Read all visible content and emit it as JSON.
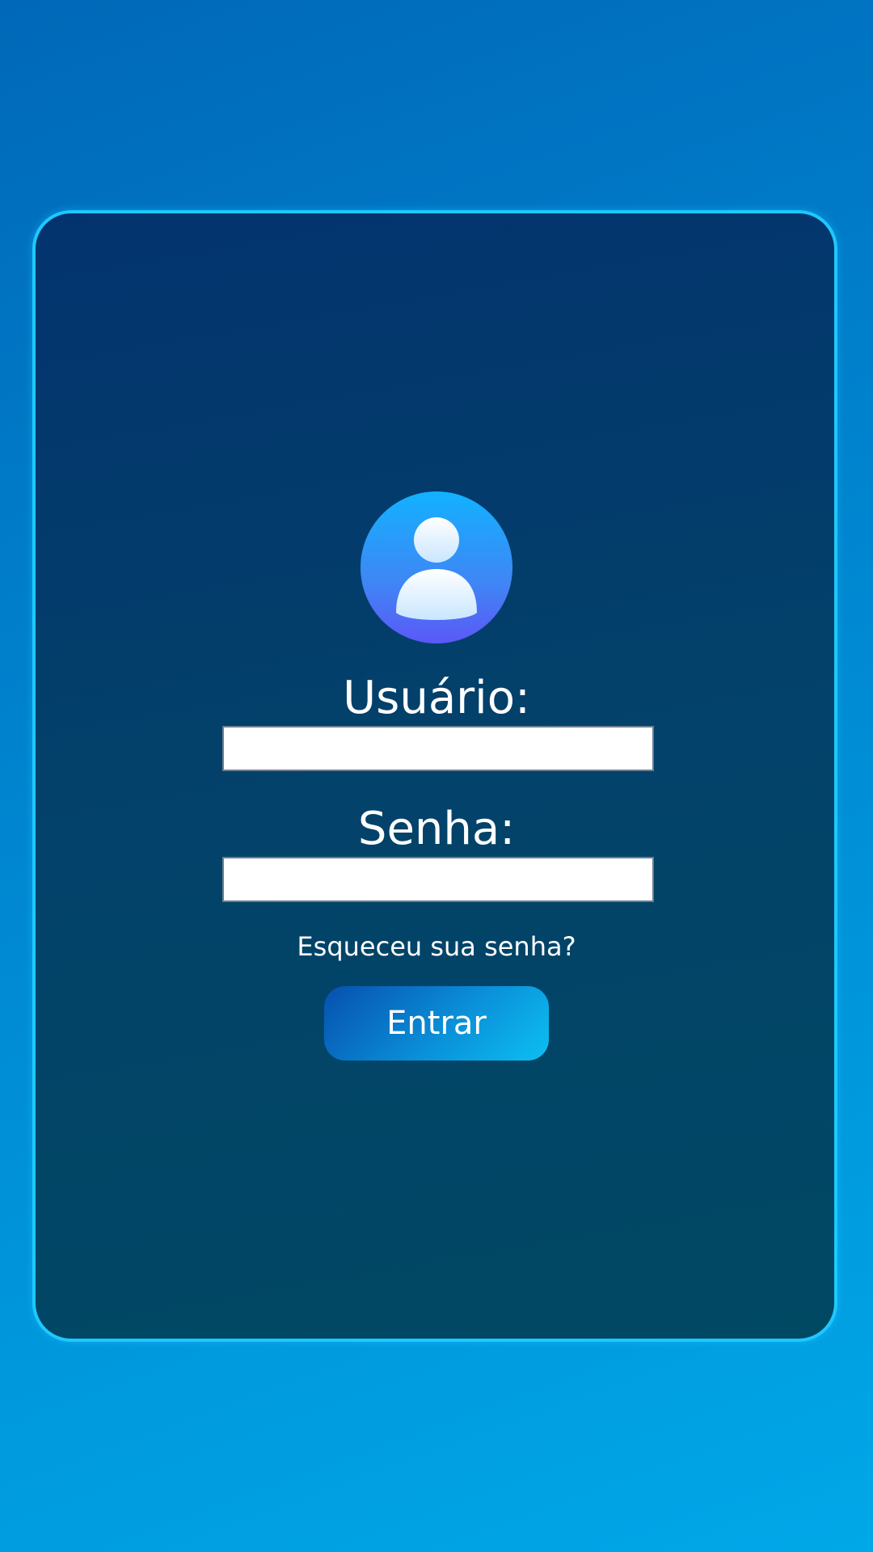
{
  "login": {
    "user_label": "Usuário:",
    "user_value": "",
    "password_label": "Senha:",
    "password_value": "",
    "forgot_link": "Esqueceu sua senha?",
    "submit_label": "Entrar"
  },
  "icons": {
    "avatar": "user-avatar-icon"
  },
  "colors": {
    "card_border": "#1ec8ff",
    "card_background": "#03336e",
    "page_background": "#0086d0",
    "button_accent": "#0cbff2"
  }
}
